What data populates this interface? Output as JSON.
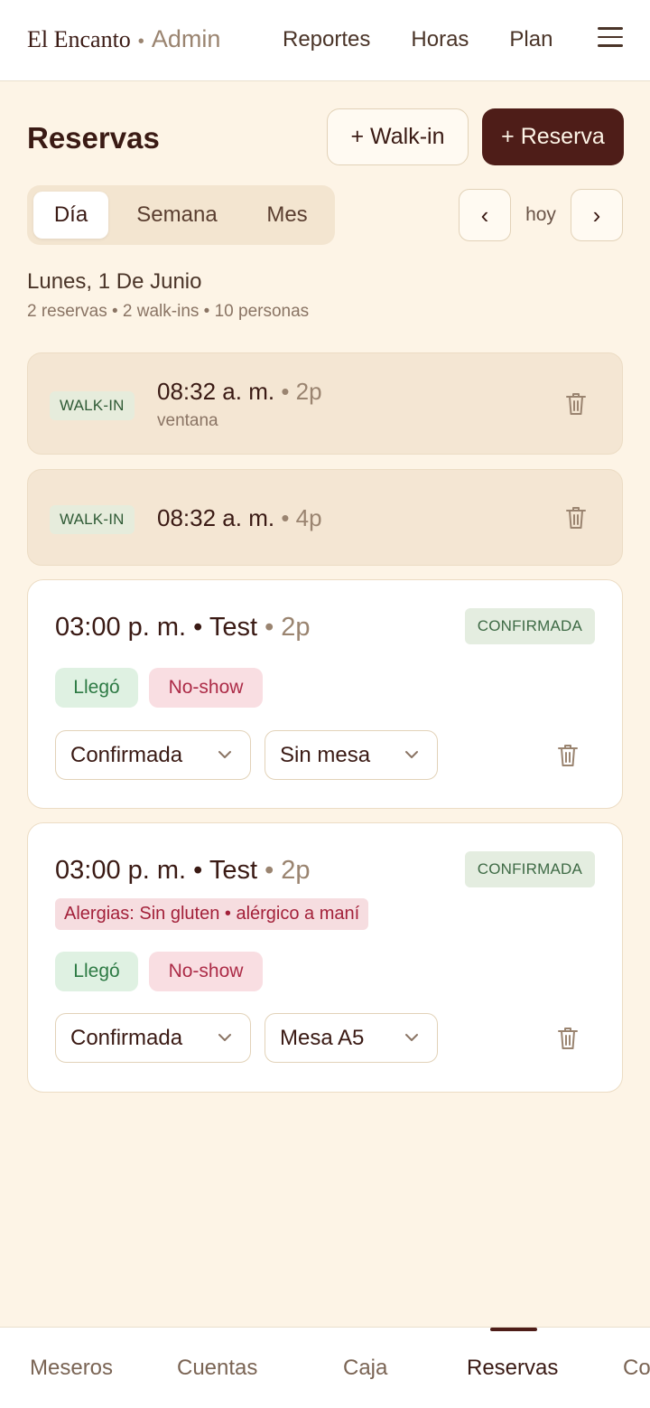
{
  "header": {
    "brand_name": "El Encanto",
    "brand_sep": "•",
    "brand_sub": "Admin",
    "nav": [
      "Reportes",
      "Horas",
      "Plan"
    ]
  },
  "page": {
    "title": "Reservas",
    "walkin_button": "+ Walk-in",
    "reserva_button": "+ Reserva"
  },
  "view_tabs": [
    "Día",
    "Semana",
    "Mes"
  ],
  "date_nav": {
    "prev": "‹",
    "today": "hoy",
    "next": "›"
  },
  "date": {
    "title": "Lunes, 1 De Junio",
    "summary": "2 reservas • 2 walk-ins • 10 personas"
  },
  "walkins": [
    {
      "badge": "WALK-IN",
      "time": "08:32 a. m.",
      "party": "• 2p",
      "note": "ventana"
    },
    {
      "badge": "WALK-IN",
      "time": "08:32 a. m.",
      "party": "• 4p",
      "note": ""
    }
  ],
  "reservations": [
    {
      "title": "03:00 p. m. • Test",
      "party": "• 2p",
      "status": "CONFIRMADA",
      "allergy": "",
      "arrived_label": "Llegó",
      "noshow_label": "No-show",
      "status_select": "Confirmada",
      "table_select": "Sin mesa"
    },
    {
      "title": "03:00 p. m. • Test",
      "party": "• 2p",
      "status": "CONFIRMADA",
      "allergy": "Alergias: Sin gluten • alérgico a maní",
      "arrived_label": "Llegó",
      "noshow_label": "No-show",
      "status_select": "Confirmada",
      "table_select": "Mesa A5"
    }
  ],
  "bottom_nav": [
    "Meseros",
    "Cuentas",
    "Caja",
    "Reservas",
    "Co"
  ],
  "colors": {
    "background": "#fdf4e6",
    "primary": "#4e1d18",
    "walkin_card": "#f4e6d3",
    "success": "#2d7a44",
    "danger": "#ac2b47"
  }
}
